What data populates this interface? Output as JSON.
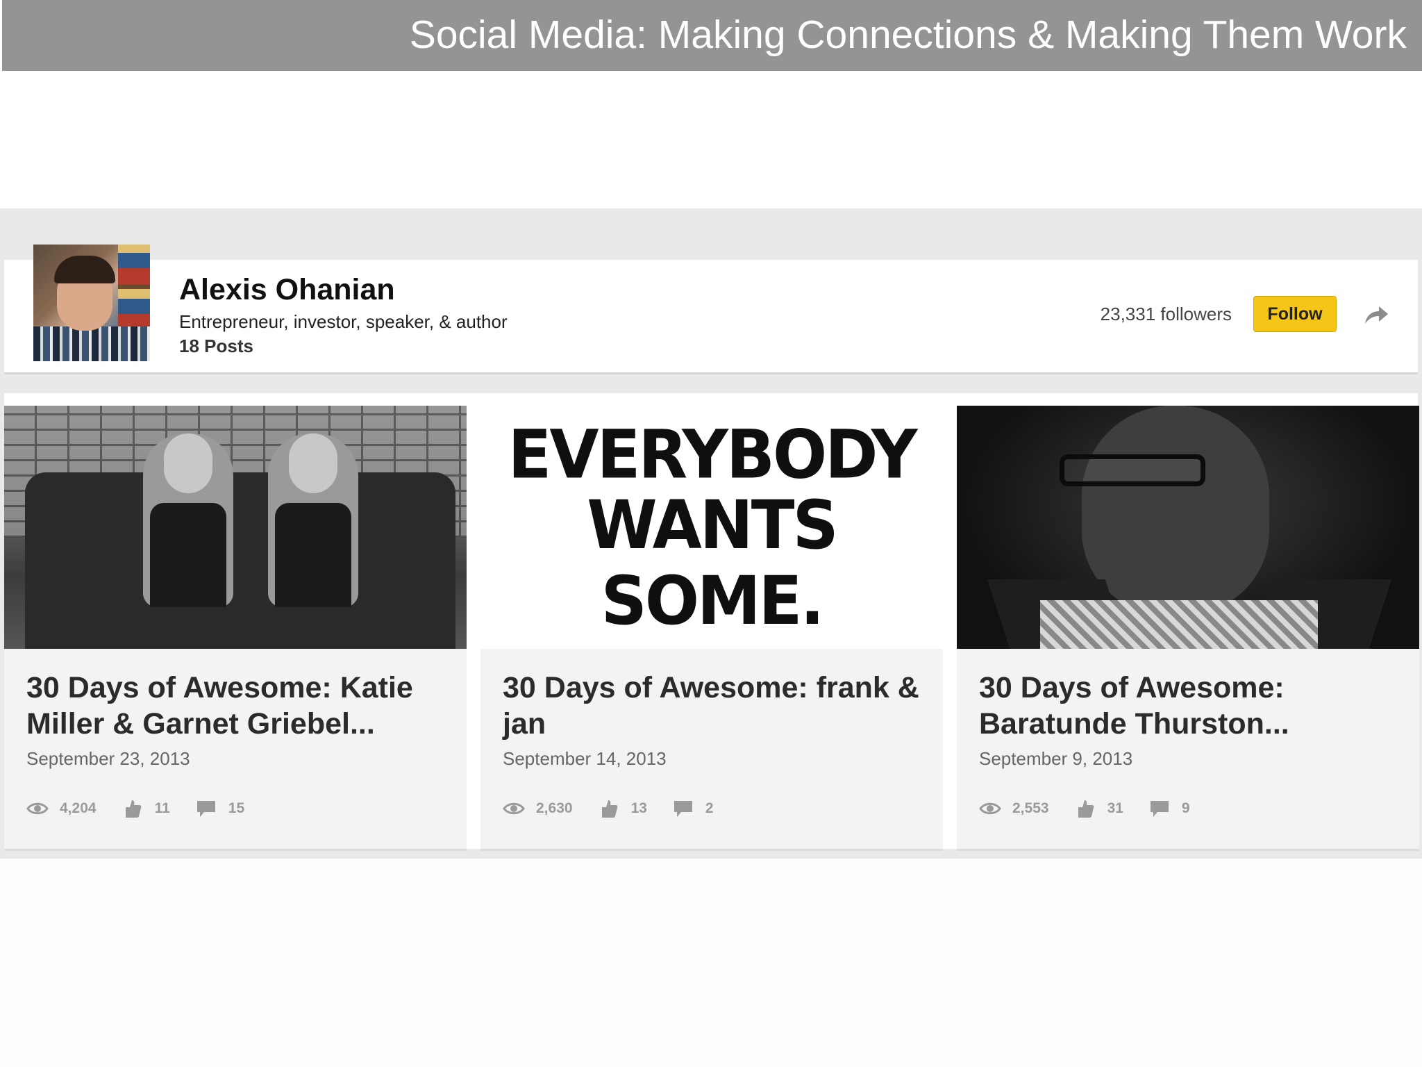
{
  "slide": {
    "title": "Social Media: Making Connections & Making Them Work"
  },
  "profile": {
    "name": "Alexis Ohanian",
    "tagline": "Entrepreneur, investor, speaker, & author",
    "posts": "18 Posts",
    "followers": "23,331 followers",
    "follow_label": "Follow",
    "avatar_icon": "avatar",
    "share_icon": "share-arrow-icon"
  },
  "posts": [
    {
      "title": "30 Days of Awesome: Katie Miller & Garnet Griebel...",
      "date": "September 23, 2013",
      "views": "4,204",
      "likes": "11",
      "comments": "15"
    },
    {
      "title": "30 Days of Awesome: frank & jan",
      "date": "September 14, 2013",
      "views": "2,630",
      "likes": "13",
      "comments": "2",
      "image_text": [
        "EVERYBODY",
        "WANTS SOME."
      ]
    },
    {
      "title": "30 Days of Awesome: Baratunde Thurston...",
      "date": "September 9, 2013",
      "views": "2,553",
      "likes": "31",
      "comments": "9"
    }
  ],
  "colors": {
    "header_bar": "#949494",
    "follow_button": "#f5c518",
    "stat_gray": "#9a9a9a"
  }
}
